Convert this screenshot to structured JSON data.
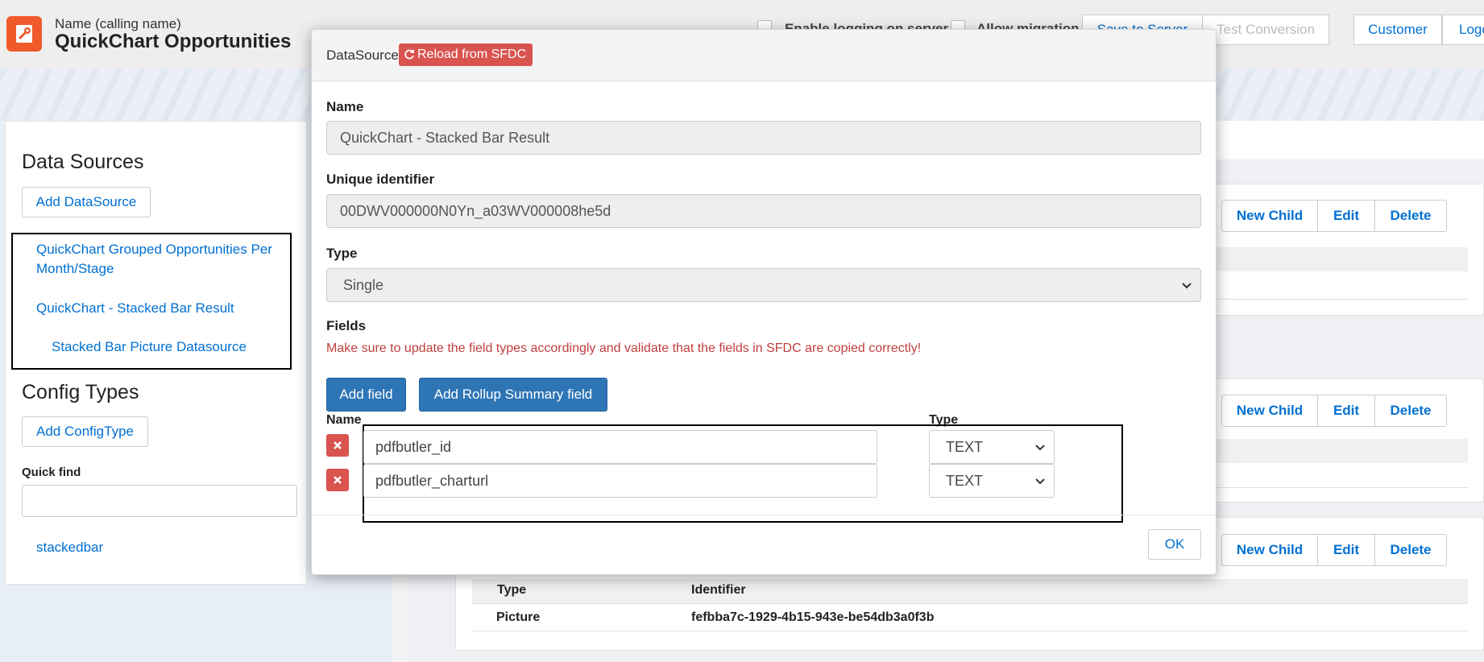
{
  "header": {
    "subtitle": "Name (calling name)",
    "title": "QuickChart Opportunities",
    "logging_label": "Enable logging on server",
    "migration_label": "Allow migration",
    "save_btn": "Save to Server",
    "test_btn": "Test Conversion",
    "customer_btn": "Customer",
    "logout_btn": "Logout"
  },
  "left": {
    "datasources_heading": "Data Sources",
    "add_datasource": "Add DataSource",
    "datasources": [
      "QuickChart Grouped Opportunities Per Month/Stage",
      "QuickChart - Stacked Bar Result",
      "Stacked Bar Picture Datasource"
    ],
    "configtypes_heading": "Config Types",
    "add_configtype": "Add ConfigType",
    "quickfind_label": "Quick find",
    "quickfind_value": "",
    "quickfind_result": "stackedbar"
  },
  "right": {
    "new_child": "New Child",
    "edit": "Edit",
    "delete": "Delete",
    "table_headers": [
      "Type",
      "Identifier"
    ],
    "row": [
      "Picture",
      "fefbba7c-1929-4b15-943e-be54db3a0f3b"
    ]
  },
  "modal": {
    "title": "DataSource",
    "reload": "Reload from SFDC",
    "name_label": "Name",
    "name_value": "QuickChart - Stacked Bar Result",
    "uid_label": "Unique identifier",
    "uid_value": "00DWV000000N0Yn_a03WV000008he5d",
    "type_label": "Type",
    "type_value": "Single",
    "fields_label": "Fields",
    "warning": "Make sure to update the field types accordingly and validate that the fields in SFDC are copied correctly!",
    "add_field": "Add field",
    "add_rollup": "Add Rollup Summary field",
    "col_name": "Name",
    "col_type": "Type",
    "fields": [
      {
        "name": "pdfbutler_id",
        "type": "TEXT"
      },
      {
        "name": "pdfbutler_charturl",
        "type": "TEXT"
      }
    ],
    "ok": "OK"
  }
}
